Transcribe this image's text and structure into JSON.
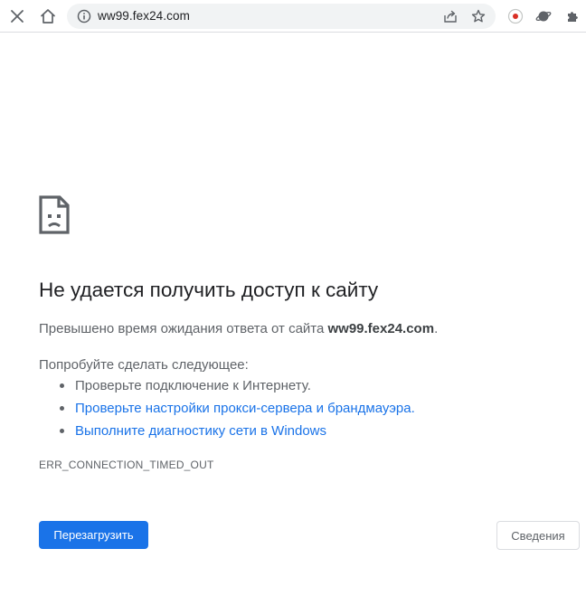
{
  "toolbar": {
    "url": "ww99.fex24.com",
    "icons": [
      "close-icon",
      "home-icon",
      "info-icon",
      "share-icon",
      "bookmark-star-icon",
      "record-extension-icon",
      "planet-extension-icon",
      "puzzle-extensions-icon"
    ]
  },
  "error": {
    "title": "Не удается получить доступ к сайту",
    "description_prefix": "Превышено время ожидания ответа от сайта ",
    "description_host": "ww99.fex24.com",
    "description_suffix": ".",
    "try_label": "Попробуйте сделать следующее:",
    "suggestions": [
      {
        "text": "Проверьте подключение к Интернету.",
        "link": false
      },
      {
        "text": "Проверьте настройки прокси-сервера и брандмауэра.",
        "link": true
      },
      {
        "text": "Выполните диагностику сети в Windows",
        "link": true
      }
    ],
    "code": "ERR_CONNECTION_TIMED_OUT"
  },
  "buttons": {
    "reload_label": "Перезагрузить",
    "details_label": "Сведения"
  },
  "colors": {
    "accent": "#1a73e8",
    "text_secondary": "#5f6368",
    "omnibox_bg": "#f1f3f4"
  }
}
